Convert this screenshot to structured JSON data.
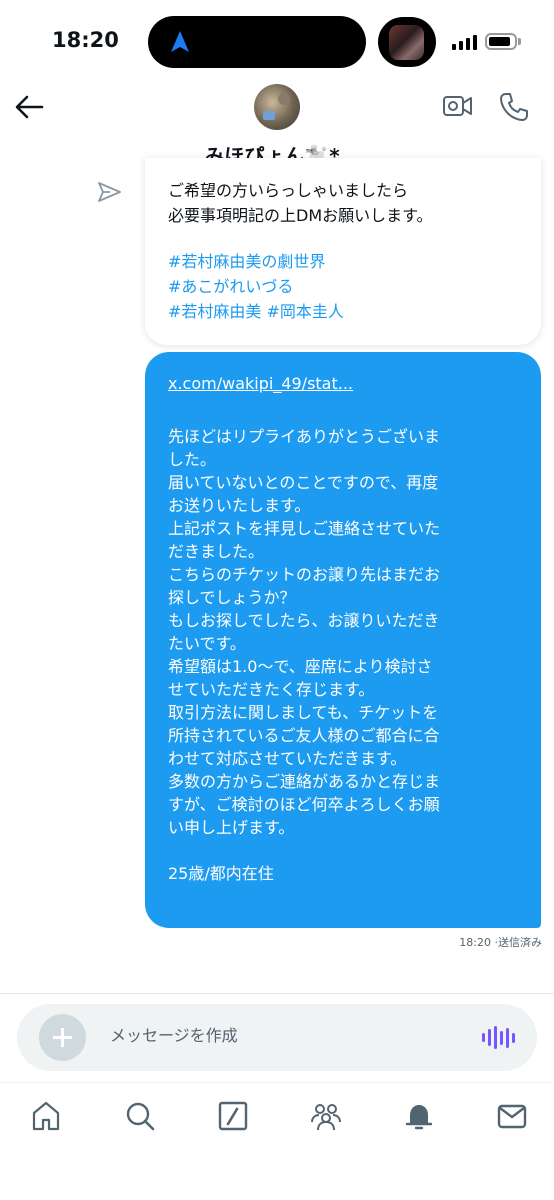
{
  "status_bar": {
    "time": "18:20"
  },
  "header": {
    "name": "みほぴょん🐩*｡"
  },
  "incoming_message": {
    "lines": [
      "ご希望の方いらっしゃいましたら",
      "必要事項明記の上DMお願いします。"
    ],
    "hashtags": [
      "#若村麻由美の劇世界",
      "#あこがれいづる",
      "#若村麻由美 #岡本圭人"
    ]
  },
  "outgoing_message": {
    "link": "x.com/wakipi_49/stat...",
    "body": "先ほどはリプライありがとうございま\nした。\n届いていないとのことですので、再度\nお送りいたします。\n上記ポストを拝見しご連絡させていた\nだきました。\nこちらのチケットのお譲り先はまだお\n探しでしょうか？\nもしお探しでしたら、お譲りいただき\nたいです。\n希望額は1.0〜で、座席により検討さ\nせていただきたく存じます。\n取引方法に関しましても、チケットを\n所持されているご友人様のご都合に合\nわせて対応させていただきます。\n多数の方からご連絡があるかと存じま\nすが、ご検討のほど何卒よろしくお願\nい申し上げます。",
    "age_line": "25歳/都内在住",
    "time": "18:20",
    "status": "·送信済み"
  },
  "composer": {
    "placeholder": "メッセージを作成"
  },
  "colors": {
    "accent": "#1d9bf0",
    "voice": "#7856ff"
  },
  "bottom_nav": [
    "home-icon",
    "search-icon",
    "grok-icon",
    "communities-icon",
    "notifications-icon",
    "messages-icon"
  ]
}
